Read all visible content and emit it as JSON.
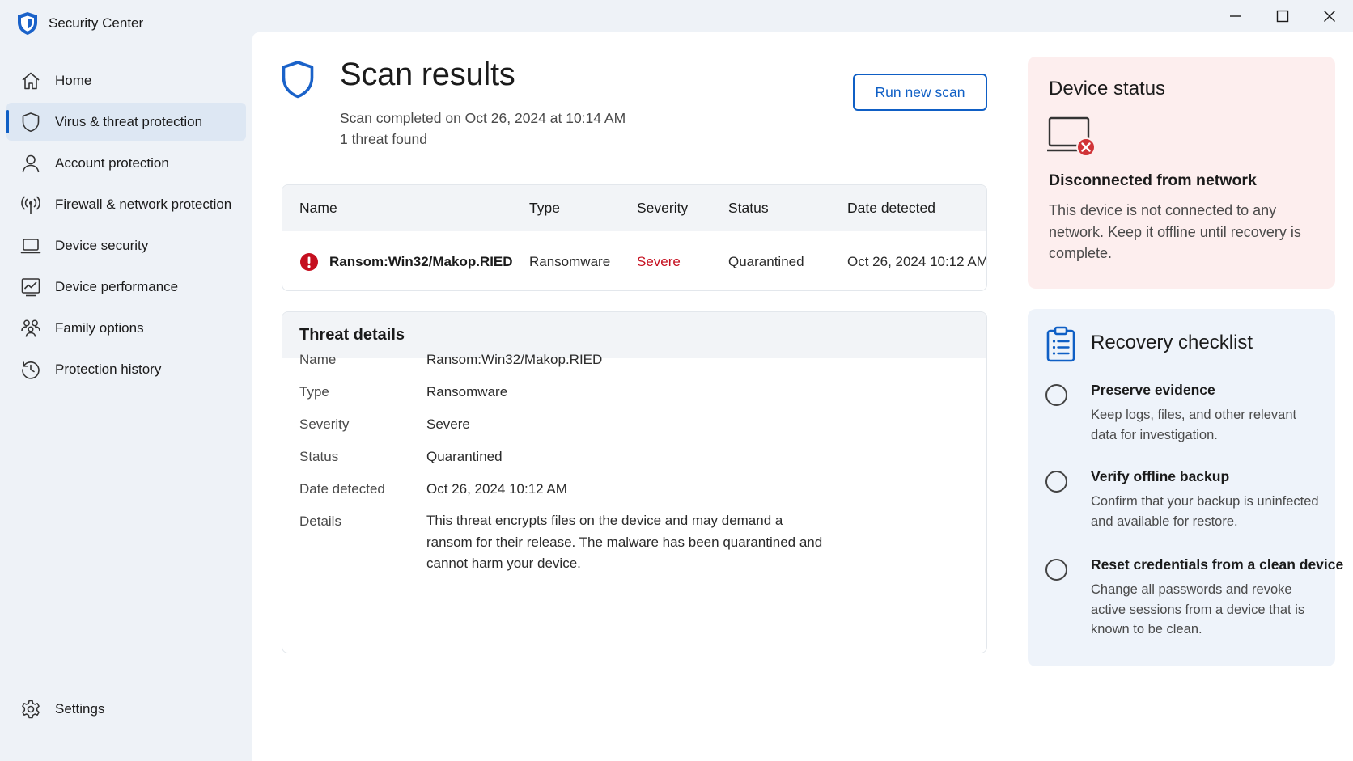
{
  "app": {
    "title": "Security Center",
    "logo_icon": "shield-icon"
  },
  "window_controls": [
    {
      "name": "minimize",
      "icon": "minimize-icon"
    },
    {
      "name": "maximize",
      "icon": "maximize-icon"
    },
    {
      "name": "close",
      "icon": "close-icon"
    }
  ],
  "sidebar": {
    "items": [
      {
        "label": "Home",
        "icon": "home-icon",
        "active": false
      },
      {
        "label": "Virus & threat protection",
        "icon": "shield-icon",
        "active": true
      },
      {
        "label": "Account protection",
        "icon": "person-icon",
        "active": false
      },
      {
        "label": "Firewall & network protection",
        "icon": "antenna-icon",
        "active": false
      },
      {
        "label": "Device security",
        "icon": "laptop-icon",
        "active": false
      },
      {
        "label": "Device performance",
        "icon": "chart-icon",
        "active": false
      },
      {
        "label": "Family options",
        "icon": "family-icon",
        "active": false
      },
      {
        "label": "Protection history",
        "icon": "history-icon",
        "active": false
      }
    ],
    "settings": {
      "label": "Settings",
      "icon": "gear-icon"
    }
  },
  "page": {
    "title": "Scan results",
    "scan_completed": "Scan completed on Oct 26, 2024 at 10:14 AM",
    "threat_count": "1 threat found",
    "run_button": "Run new scan"
  },
  "results_table": {
    "columns": [
      "Name",
      "Type",
      "Severity",
      "Status",
      "Date detected"
    ],
    "rows": [
      {
        "name": "Ransom:Win32/Makop.RIED",
        "type": "Ransomware",
        "severity": "Severe",
        "status": "Quarantined",
        "date": "Oct 26, 2024 10:12 AM"
      }
    ]
  },
  "threat_details": {
    "title": "Threat details",
    "fields": [
      {
        "label": "Name",
        "value": "Ransom:Win32/Makop.RIED"
      },
      {
        "label": "Type",
        "value": "Ransomware"
      },
      {
        "label": "Severity",
        "value": "Severe"
      },
      {
        "label": "Status",
        "value": "Quarantined"
      },
      {
        "label": "Date detected",
        "value": "Oct 26, 2024 10:12 AM"
      },
      {
        "label": "Details",
        "value": "This threat encrypts files on the device and may demand a ransom for their release. The malware has been quarantined and cannot harm your device."
      }
    ]
  },
  "device_status": {
    "title": "Device status",
    "status": "Disconnected from network",
    "description": "This device is not connected to any network. Keep it offline until recovery is complete."
  },
  "recovery_checklist": {
    "title": "Recovery checklist",
    "items": [
      {
        "title": "Preserve evidence",
        "description": "Keep logs, files, and other relevant data for investigation.",
        "checked": false
      },
      {
        "title": "Verify offline backup",
        "description": "Confirm that your backup is uninfected and available for restore.",
        "checked": false
      },
      {
        "title": "Reset credentials from a clean device",
        "description": "Change all passwords and revoke active sessions from a device that is known to be clean.",
        "checked": false
      }
    ]
  },
  "colors": {
    "accent": "#0f5fc5",
    "severe": "#c50f1f",
    "sidebar_bg": "#eef2f7",
    "status_card_bg": "#fdeeee",
    "checklist_card_bg": "#eef3fa"
  }
}
